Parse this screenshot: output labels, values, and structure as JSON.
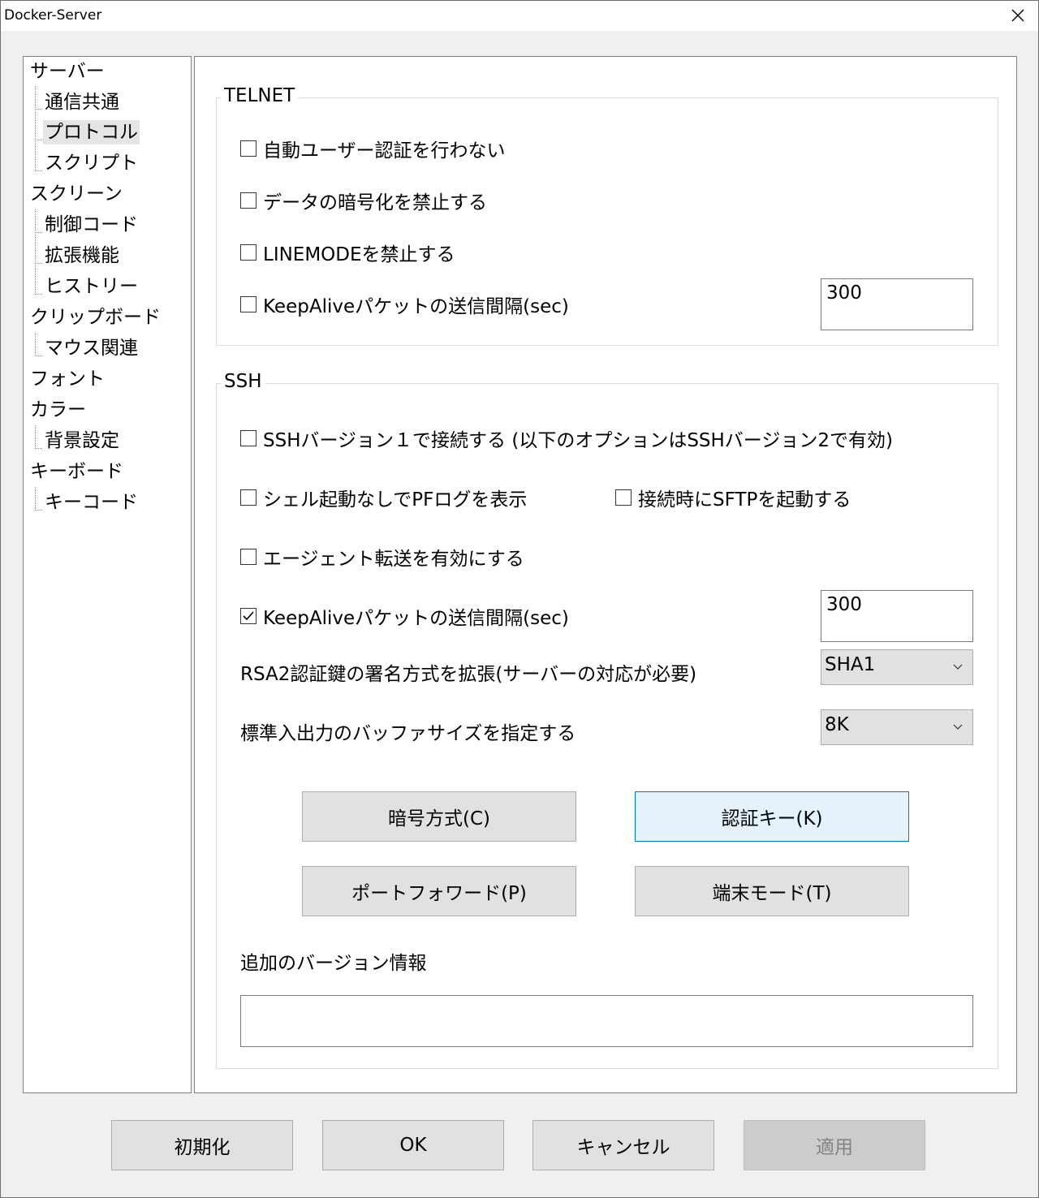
{
  "window": {
    "title": "Docker-Server"
  },
  "tree": {
    "items": [
      {
        "label": "サーバー",
        "level": 0
      },
      {
        "label": "通信共通",
        "level": 1
      },
      {
        "label": "プロトコル",
        "level": 1,
        "selected": true
      },
      {
        "label": "スクリプト",
        "level": 1
      },
      {
        "label": "スクリーン",
        "level": 0
      },
      {
        "label": "制御コード",
        "level": 1
      },
      {
        "label": "拡張機能",
        "level": 1
      },
      {
        "label": "ヒストリー",
        "level": 1
      },
      {
        "label": "クリップボード",
        "level": 0
      },
      {
        "label": "マウス関連",
        "level": 1
      },
      {
        "label": "フォント",
        "level": 0
      },
      {
        "label": "カラー",
        "level": 0
      },
      {
        "label": "背景設定",
        "level": 1
      },
      {
        "label": "キーボード",
        "level": 0
      },
      {
        "label": "キーコード",
        "level": 1
      }
    ]
  },
  "telnet": {
    "title": "TELNET",
    "no_auto_auth": {
      "label": "自動ユーザー認証を行わない",
      "checked": false
    },
    "no_encrypt": {
      "label": "データの暗号化を禁止する",
      "checked": false
    },
    "no_linemode": {
      "label": "LINEMODEを禁止する",
      "checked": false
    },
    "keepalive": {
      "label": "KeepAliveパケットの送信間隔(sec)",
      "checked": false,
      "value": "300"
    }
  },
  "ssh": {
    "title": "SSH",
    "ssh_v1": {
      "label": "SSHバージョン１で接続する (以下のオプションはSSHバージョン2で有効)",
      "checked": false
    },
    "pf_log": {
      "label": "シェル起動なしでPFログを表示",
      "checked": false
    },
    "sftp_on_connect": {
      "label": "接続時にSFTPを起動する",
      "checked": false
    },
    "agent_forward": {
      "label": "エージェント転送を有効にする",
      "checked": false
    },
    "keepalive": {
      "label": "KeepAliveパケットの送信間隔(sec)",
      "checked": true,
      "value": "300"
    },
    "rsa2_label": "RSA2認証鍵の署名方式を拡張(サーバーの対応が必要)",
    "rsa2_value": "SHA1",
    "buffer_label": "標準入出力のバッファサイズを指定する",
    "buffer_value": "8K",
    "cipher_button": "暗号方式(C)",
    "authkey_button": "認証キー(K)",
    "portforward_button": "ポートフォワード(P)",
    "termmode_button": "端末モード(T)",
    "version_label": "追加のバージョン情報",
    "version_value": ""
  },
  "footer": {
    "reset": "初期化",
    "ok": "OK",
    "cancel": "キャンセル",
    "apply": "適用"
  }
}
